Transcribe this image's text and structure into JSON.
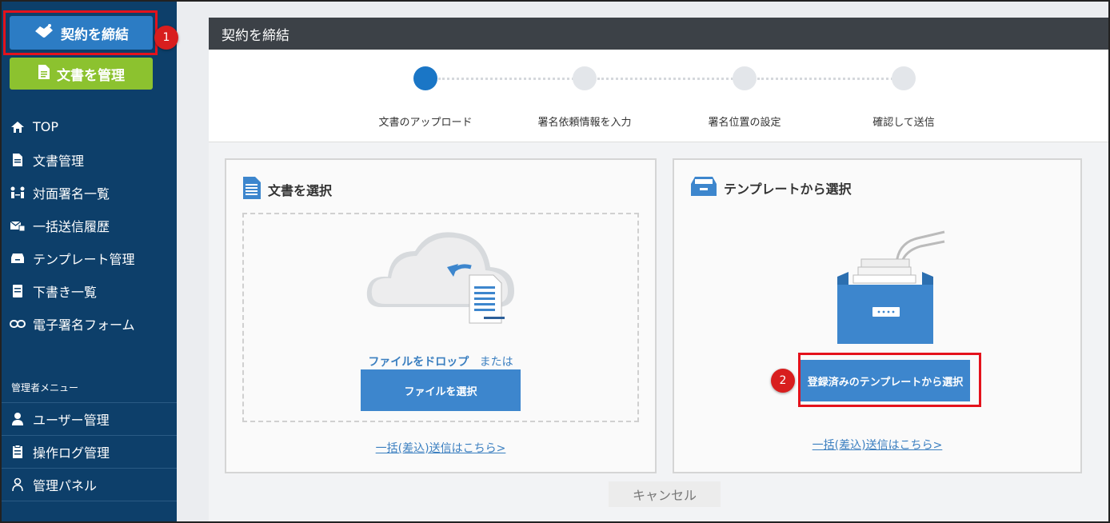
{
  "sidebar": {
    "contract_button": "契約を締結",
    "docs_button": "文書を管理",
    "items": [
      {
        "label": "TOP",
        "icon": "home-icon"
      },
      {
        "label": "文書管理",
        "icon": "document-icon"
      },
      {
        "label": "対面署名一覧",
        "icon": "face-to-face-icon"
      },
      {
        "label": "一括送信履歴",
        "icon": "bulk-send-icon"
      },
      {
        "label": "テンプレート管理",
        "icon": "template-box-icon"
      },
      {
        "label": "下書き一覧",
        "icon": "draft-icon"
      },
      {
        "label": "電子署名フォーム",
        "icon": "link-icon"
      }
    ],
    "admin_label": "管理者メニュー",
    "admin_items": [
      {
        "label": "ユーザー管理",
        "icon": "user-icon"
      },
      {
        "label": "操作ログ管理",
        "icon": "log-icon"
      },
      {
        "label": "管理パネル",
        "icon": "admin-panel-icon"
      }
    ]
  },
  "annotations": {
    "badge_1": "1",
    "badge_2": "2",
    "highlight_color": "#e4121c"
  },
  "main": {
    "header_title": "契約を締結",
    "steps": [
      {
        "label": "文書のアップロード",
        "active": true
      },
      {
        "label": "署名依頼情報を入力",
        "active": false
      },
      {
        "label": "署名位置の設定",
        "active": false
      },
      {
        "label": "確認して送信",
        "active": false
      }
    ],
    "left_card": {
      "title": "文書を選択",
      "drop_text": "ファイルをドロップ",
      "drop_or": "または",
      "button": "ファイルを選択",
      "link": "一括(差込)送信はこちら>"
    },
    "right_card": {
      "title": "テンプレートから選択",
      "button": "登録済みのテンプレートから選択",
      "link": "一括(差込)送信はこちら>"
    },
    "cancel_button": "キャンセル"
  },
  "colors": {
    "sidebar_bg": "#0d3f6a",
    "primary": "#2c7cc4",
    "green": "#8cc22f",
    "header_bg": "#3c4147"
  }
}
